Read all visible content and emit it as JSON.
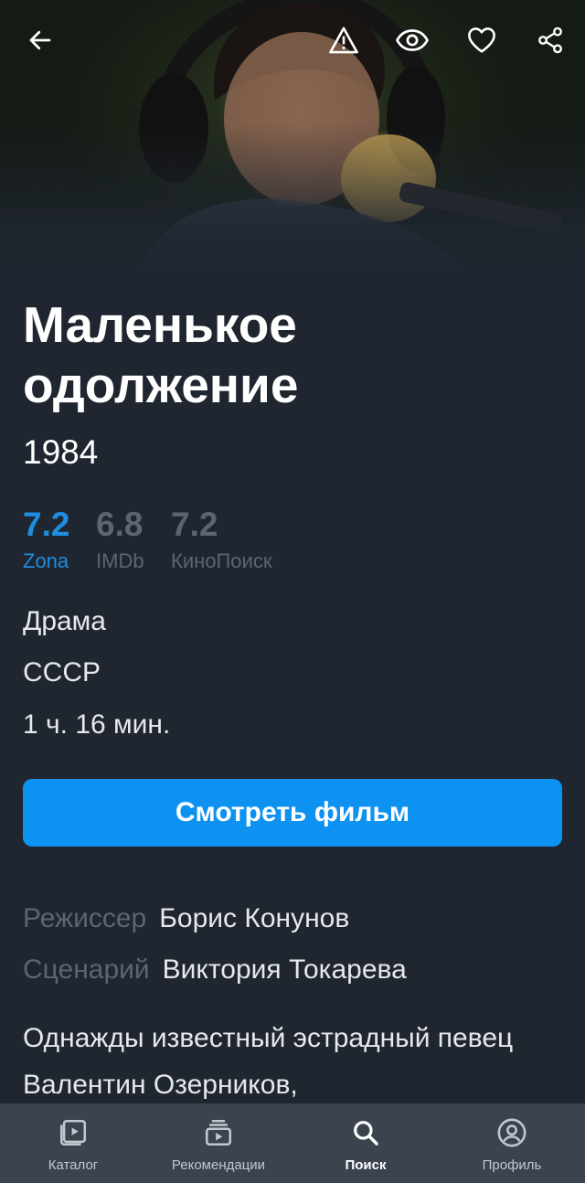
{
  "movie": {
    "title": "Маленькое одолжение",
    "year": "1984",
    "ratings": [
      {
        "value": "7.2",
        "source": "Zona",
        "color": "#1f8de0"
      },
      {
        "value": "6.8",
        "source": "IMDb",
        "color": "#5b6673"
      },
      {
        "value": "7.2",
        "source": "КиноПоиск",
        "color": "#5b6673"
      }
    ],
    "genre": "Драма",
    "country": "СССР",
    "duration": "1 ч. 16 мин.",
    "watch_label": "Смотреть фильм",
    "director_label": "Режиссер",
    "director": "Борис Конунов",
    "writer_label": "Сценарий",
    "writer": "Виктория Токарева",
    "description": "Однажды известный эстрадный певец Валентин Озерников,"
  },
  "top_bar": {
    "icons": [
      "back-arrow-icon",
      "warning-icon",
      "eye-icon",
      "heart-icon",
      "share-icon"
    ]
  },
  "bottom_nav": {
    "items": [
      {
        "label": "Каталог",
        "icon": "catalog-icon"
      },
      {
        "label": "Рекомендации",
        "icon": "recommendations-icon"
      },
      {
        "label": "Поиск",
        "icon": "search-icon",
        "active": true
      },
      {
        "label": "Профиль",
        "icon": "profile-icon"
      }
    ]
  },
  "colors": {
    "background": "#1f2630",
    "accent": "#0d92f2",
    "nav_background": "#3b434e",
    "muted": "#5b6673"
  }
}
